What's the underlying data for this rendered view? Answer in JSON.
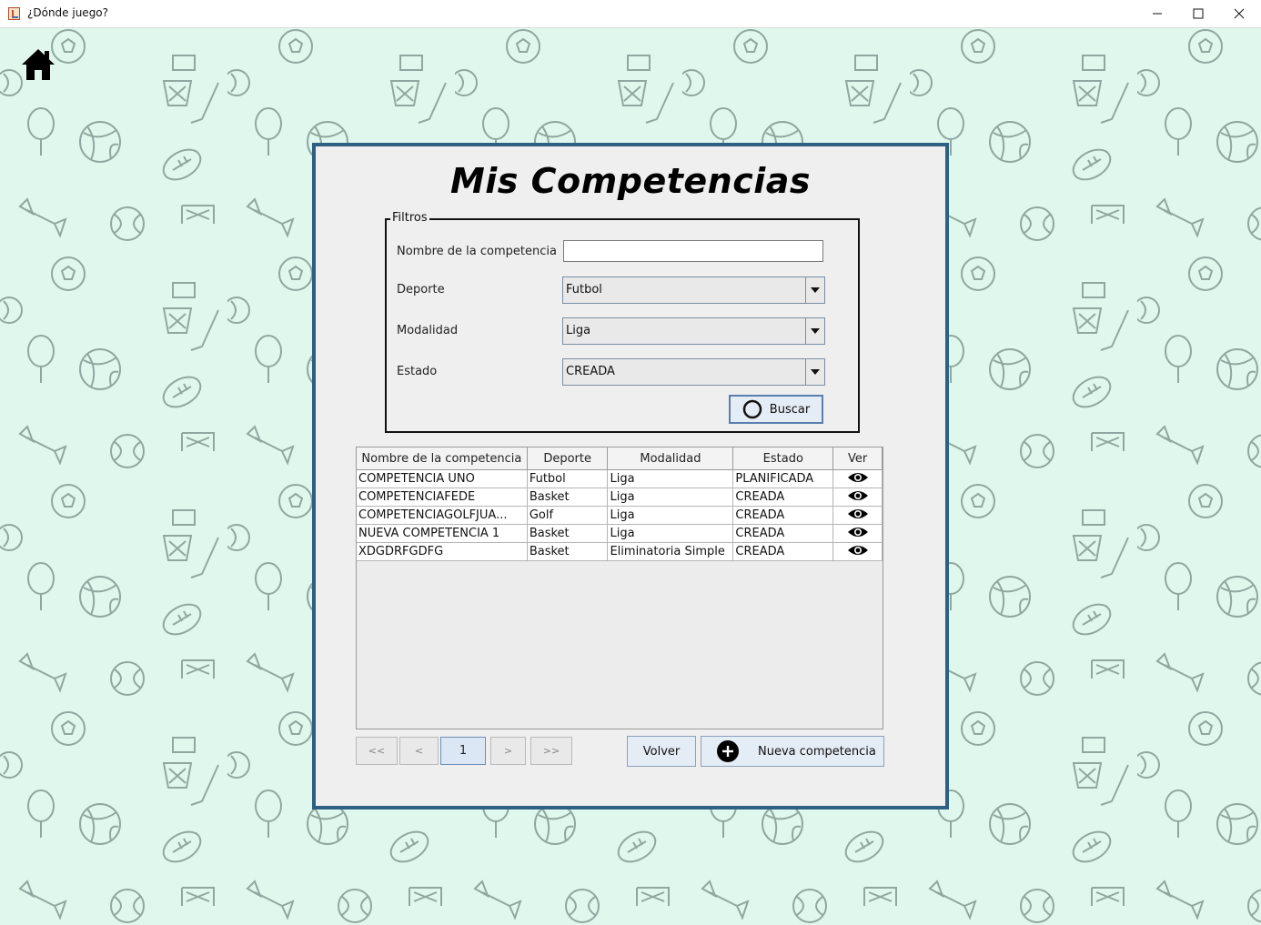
{
  "window": {
    "title": "¿Dónde juego?"
  },
  "colors": {
    "background": "#dff7ec",
    "panel_border": "#2d6083",
    "panel_background": "#efefef",
    "pattern_stroke": "#8fa7a0"
  },
  "page": {
    "title": "Mis Competencias"
  },
  "filters": {
    "legend": "Filtros",
    "name_label": "Nombre de la competencia",
    "name_value": "",
    "sport_label": "Deporte",
    "sport_value": "Futbol",
    "mode_label": "Modalidad",
    "mode_value": "Liga",
    "state_label": "Estado",
    "state_value": "CREADA",
    "search_label": "Buscar"
  },
  "table": {
    "headers": [
      "Nombre de la competencia",
      "Deporte",
      "Modalidad",
      "Estado",
      "Ver"
    ],
    "rows": [
      [
        "COMPETENCIA UNO",
        "Futbol",
        "Liga",
        "PLANIFICADA"
      ],
      [
        "COMPETENCIAFEDE",
        "Basket",
        "Liga",
        "CREADA"
      ],
      [
        "COMPETENCIAGOLFJUA...",
        "Golf",
        "Liga",
        "CREADA"
      ],
      [
        "NUEVA COMPETENCIA 1",
        "Basket",
        "Liga",
        "CREADA"
      ],
      [
        "XDGDRFGDFG",
        "Basket",
        "Eliminatoria Simple",
        "CREADA"
      ]
    ]
  },
  "pagination": {
    "first": "<<",
    "prev": "<",
    "page": "1",
    "next": ">",
    "last": ">>"
  },
  "actions": {
    "back": "Volver",
    "new": "Nueva competencia"
  }
}
